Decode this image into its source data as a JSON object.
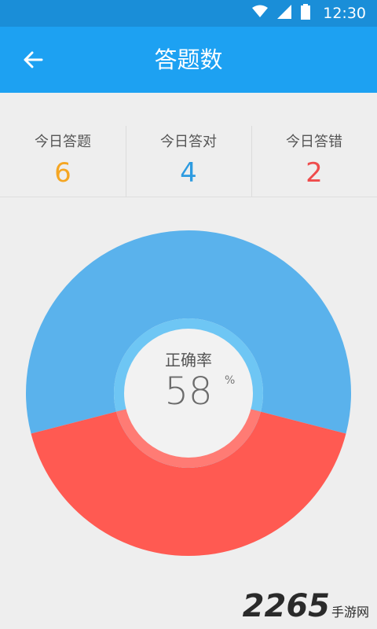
{
  "status_bar": {
    "time": "12:30",
    "icons": [
      "wifi-icon",
      "signal-icon",
      "battery-icon"
    ]
  },
  "app_bar": {
    "title": "答题数",
    "back_icon": "arrow-left-icon"
  },
  "stats": [
    {
      "label": "今日答题",
      "value": "6",
      "color": "#f5a623"
    },
    {
      "label": "今日答对",
      "value": "4",
      "color": "#2d9be0"
    },
    {
      "label": "今日答错",
      "value": "2",
      "color": "#ef4c4c"
    }
  ],
  "center": {
    "label": "正确率",
    "value": "58",
    "unit": "%"
  },
  "chart_data": {
    "type": "pie",
    "values": [
      58,
      42
    ],
    "colors": [
      "#5ab2ec",
      "#ff5a52"
    ]
  },
  "watermark": {
    "number": "2265",
    "text": "手游网"
  },
  "colors": {
    "status_bar": "#1a8ed8",
    "app_bar": "#1da1f2",
    "background": "#eeeeee"
  }
}
